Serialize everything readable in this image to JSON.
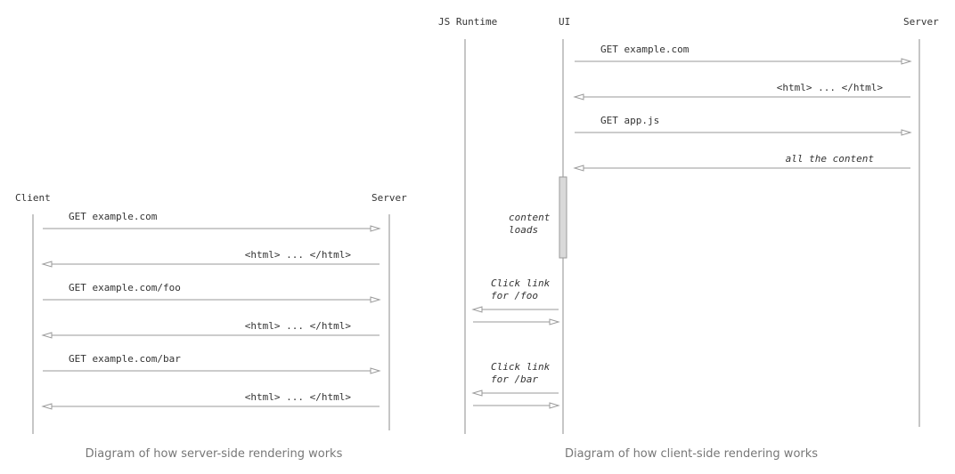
{
  "ssr": {
    "participants": [
      "Client",
      "Server"
    ],
    "messages": [
      {
        "label": "GET example.com",
        "dir": "right"
      },
      {
        "label": "<html> ... </html>",
        "dir": "left"
      },
      {
        "label": "GET example.com/foo",
        "dir": "right"
      },
      {
        "label": "<html> ... </html>",
        "dir": "left"
      },
      {
        "label": "GET example.com/bar",
        "dir": "right"
      },
      {
        "label": "<html> ... </html>",
        "dir": "left"
      }
    ],
    "caption": "Diagram of how server-side rendering works"
  },
  "csr": {
    "participants": [
      "JS Runtime",
      "UI",
      "Server"
    ],
    "messages": [
      {
        "label": "GET example.com",
        "dir": "right"
      },
      {
        "label": "<html> ... </html>",
        "dir": "left"
      },
      {
        "label": "GET app.js",
        "dir": "right"
      },
      {
        "label": "all the content",
        "dir": "left"
      }
    ],
    "activation_note": [
      "content",
      "loads"
    ],
    "clicks": [
      {
        "lines": [
          "Click link",
          "for /foo"
        ]
      },
      {
        "lines": [
          "Click link",
          "for /bar"
        ]
      }
    ],
    "caption": "Diagram of how client-side rendering works"
  }
}
